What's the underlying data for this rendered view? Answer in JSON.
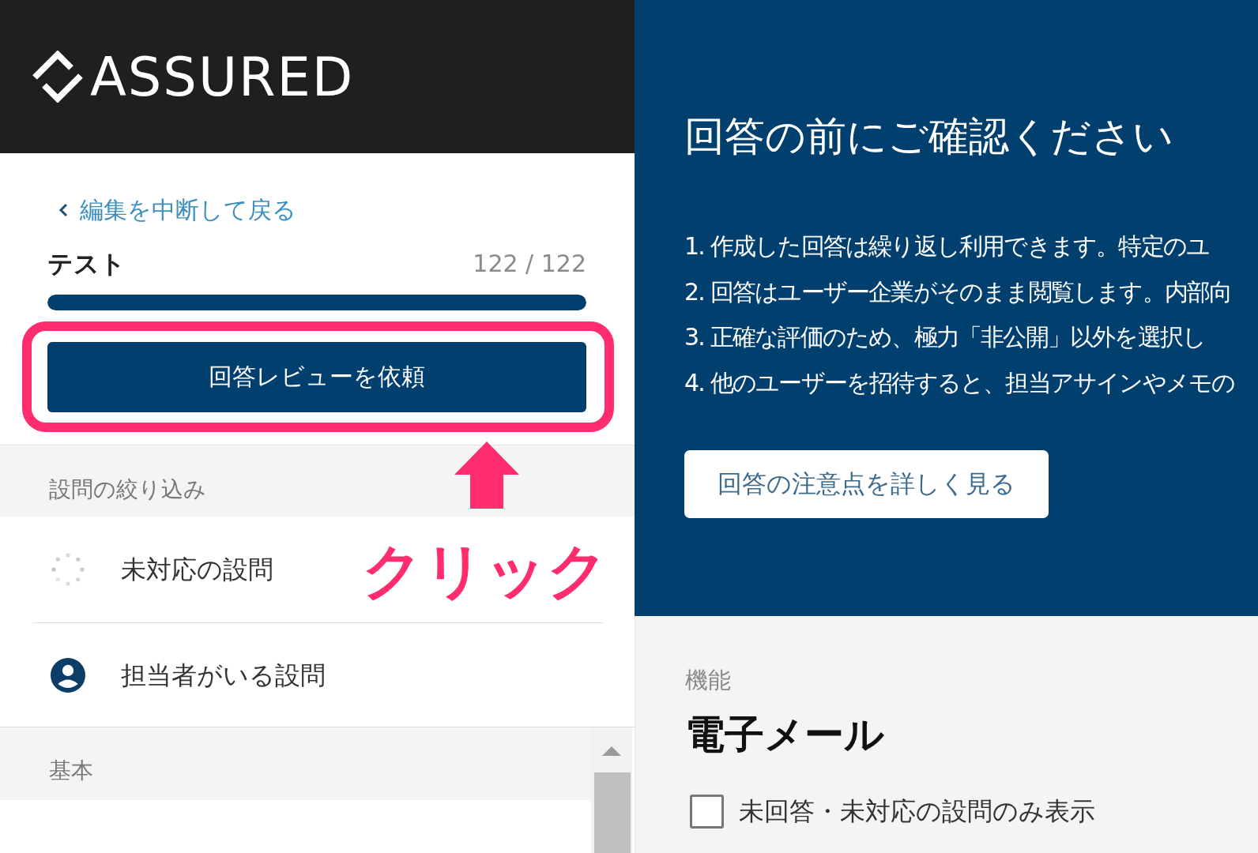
{
  "header": {
    "logo": "ASSURED"
  },
  "sidebar": {
    "back_link": "編集を中断して戻る",
    "questionnaire": {
      "title": "テスト",
      "count": "122 / 122",
      "level": 1
    },
    "review_button": {
      "label": "回答レビューを依頼",
      "highlighted": true
    },
    "filter": {
      "title": "設問の絞り込み",
      "items": [
        {
          "kind": "unanswered",
          "label": "未対応の設問"
        },
        {
          "kind": "assigned",
          "label": "担当者がいる設問"
        }
      ]
    },
    "category": {
      "title": "基本"
    }
  },
  "annotation": {
    "label": "クリック"
  },
  "notice": {
    "title": "回答の前にご確認ください",
    "items": [
      "1. 作成した回答は繰り返し利用できます。特定のユ",
      "2. 回答はユーザー企業がそのまま閲覧します。内部向",
      "3. 正確な評価のため、極力「非公開」以外を選択し",
      "4. 他のユーザーを招待すると、担当アサインやメモの"
    ],
    "button": "回答の注意点を詳しく見る"
  },
  "content": {
    "category": "機能",
    "title": "電子メール",
    "filter_checkbox": {
      "label": "未回答・未対応の設問のみ表示",
      "checked": false
    }
  }
}
